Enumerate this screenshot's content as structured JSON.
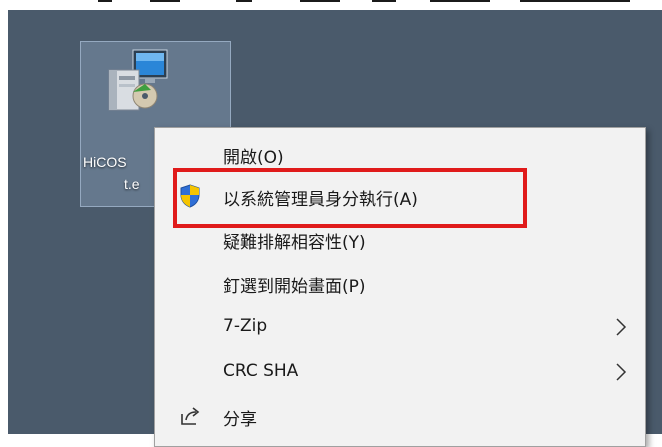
{
  "desktop": {
    "file": {
      "name_line1": "HiCOS",
      "name_line2": "t.e",
      "icon": "installer-icon"
    }
  },
  "context_menu": {
    "items": [
      {
        "label": "開啟(O)",
        "icon": ""
      },
      {
        "label": "以系統管理員身分執行(A)",
        "icon": "uac-shield-icon"
      },
      {
        "label": "疑難排解相容性(Y)",
        "icon": ""
      },
      {
        "label": "釘選到開始畫面(P)",
        "icon": ""
      },
      {
        "label": "7-Zip",
        "icon": "",
        "submenu": true
      },
      {
        "label": "CRC SHA",
        "icon": "",
        "submenu": true
      },
      {
        "label": "分享",
        "icon": "share-icon"
      }
    ]
  },
  "annotation": {
    "highlight_color": "#e01b1b",
    "highlighted_item": "以系統管理員身分執行(A)"
  },
  "colors": {
    "desktop_bg": "#4a5a6b",
    "menu_bg": "#f2f2f2"
  }
}
